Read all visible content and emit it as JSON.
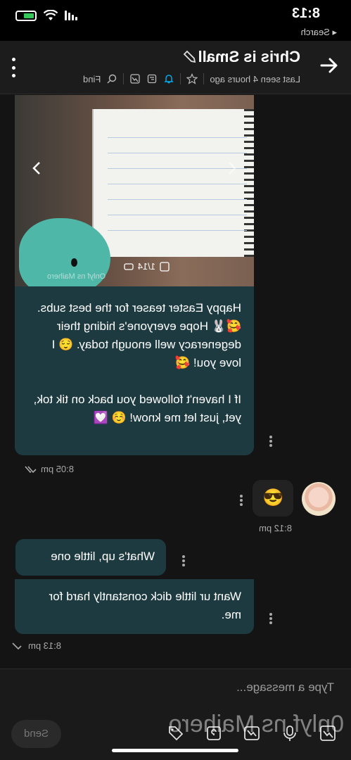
{
  "status_bar": {
    "time": "8:13",
    "back_label": "◂ Search"
  },
  "header": {
    "title": "Chris is Small",
    "last_seen": "Last seen 4 hours ago",
    "find_label": "Find"
  },
  "media": {
    "counter": "1/14",
    "watermark": "Onlyf ns Maihero"
  },
  "messages": [
    {
      "id": "caption",
      "text": "Happy Easter teaser for the best subs. 🥰🐰 Hope everyone's hiding their degeneracy well enough today. 😌 I love you! 🥰\n\nIf I haven't followed you back on tik tok, yet, just let me know! ☺️ 💟",
      "time": "8:05 pm"
    },
    {
      "id": "sent",
      "text": "😎",
      "time": "8:12 pm"
    },
    {
      "id": "short",
      "text": "What's up, little one"
    },
    {
      "id": "long",
      "text": "Want ur little dick constantly hard for me.",
      "time": "8:13 pm"
    }
  ],
  "composer": {
    "placeholder": "Type a message...",
    "send_label": "Send"
  },
  "overlay_watermark": "0nlyf ns Maihero",
  "colors": {
    "incoming_bubble": "#1c3a40",
    "accent": "#00aff0"
  }
}
